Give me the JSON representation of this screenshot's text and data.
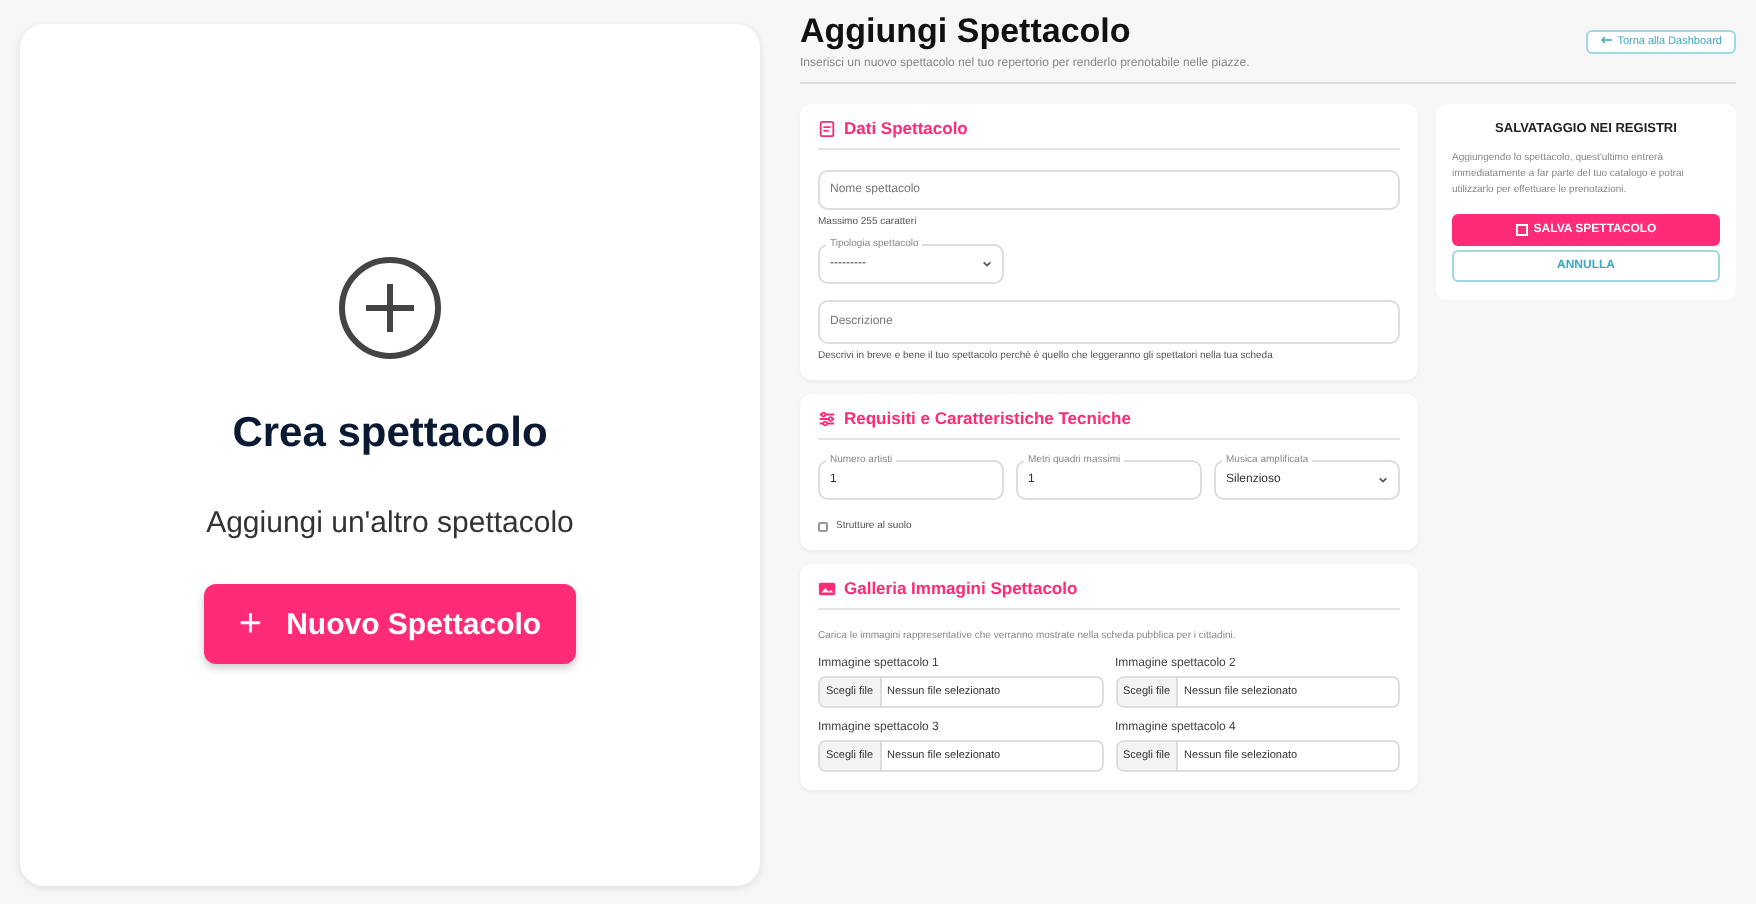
{
  "create_card": {
    "title": "Crea spettacolo",
    "subtitle": "Aggiungi un'altro spettacolo",
    "button": {
      "icon": "+",
      "label": "Nuovo Spettacolo"
    }
  },
  "header": {
    "title": "Aggiungi Spettacolo",
    "subtitle": "Inserisci un nuovo spettacolo nel tuo repertorio per renderlo prenotabile nelle piazze.",
    "back_button": "Torna alla Dashboard"
  },
  "sections": [
    {
      "kind": "details",
      "title": "Dati Spettacolo",
      "name_placeholder": "Nome spettacolo",
      "name_hint": "Massimo 255 caratteri",
      "type_label": "Tipologia spettacolo",
      "type_value": "---------",
      "description_placeholder": "Descrizione",
      "description_hint": "Descrivi in breve e bene il tuo spettacolo perchè è quello che leggeranno gli spettatori nella tua scheda"
    },
    {
      "kind": "requirements",
      "title": "Requisiti e Caratteristiche Tecniche",
      "fields": [
        {
          "kind": "input",
          "label": "Numero artisti",
          "value": "1"
        },
        {
          "kind": "input",
          "label": "Metri quadri massimi",
          "value": "1"
        },
        {
          "kind": "select",
          "label": "Musica amplificata",
          "value": "Silenzioso"
        }
      ],
      "checkbox": {
        "label": "Strutture al suolo",
        "checked": false
      }
    },
    {
      "kind": "gallery",
      "title": "Galleria Immagini Spettacolo",
      "description": "Carica le immagini rappresentative che verranno mostrate nella scheda pubblica per i cittadini.",
      "images": [
        {
          "label": "Immagine spettacolo 1",
          "button": "Scegli file",
          "status": "Nessun file selezionato"
        },
        {
          "label": "Immagine spettacolo 2",
          "button": "Scegli file",
          "status": "Nessun file selezionato"
        },
        {
          "label": "Immagine spettacolo 3",
          "button": "Scegli file",
          "status": "Nessun file selezionato"
        },
        {
          "label": "Immagine spettacolo 4",
          "button": "Scegli file",
          "status": "Nessun file selezionato"
        }
      ]
    }
  ],
  "save_panel": {
    "title": "SALVATAGGIO NEI REGISTRI",
    "text": "Aggiungendo lo spettacolo, quest'ultimo entrerà immediatamente a far parte del tuo catalogo e potrai utilizzarlo per effettuare le prenotazioni.",
    "save_button": "SALVA SPETTACOLO",
    "cancel_button": "ANNULLA"
  }
}
